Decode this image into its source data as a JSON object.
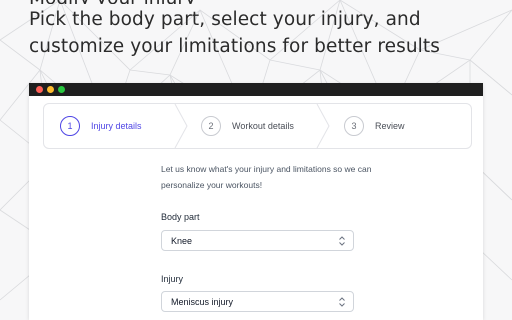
{
  "headline": {
    "line1": "Pick the body part, select your injury, and",
    "line2": "customize your limitations for better results"
  },
  "stepper": {
    "steps": [
      {
        "number": "1",
        "label": "Injury details",
        "state": "active"
      },
      {
        "number": "2",
        "label": "Workout details",
        "state": "upcoming"
      },
      {
        "number": "3",
        "label": "Review",
        "state": "upcoming"
      }
    ]
  },
  "form": {
    "intro": "Let us know what's your injury and limitations so we can personalize your workouts!",
    "body_part": {
      "label": "Body part",
      "value": "Knee"
    },
    "injury": {
      "label": "Injury",
      "value": "Meniscus injury"
    }
  },
  "colors": {
    "accent": "#4f46e5",
    "window_titlebar": "#1f1f1f",
    "traffic_red": "#ff5f57",
    "traffic_yellow": "#febc2e",
    "traffic_green": "#28c840"
  },
  "icons": [
    "chevron-right-icon",
    "select-caret-icon"
  ]
}
